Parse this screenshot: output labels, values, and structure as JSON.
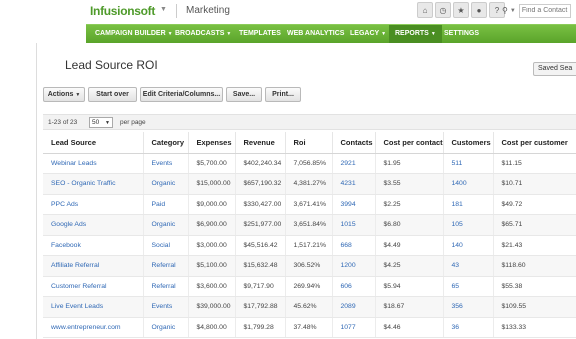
{
  "header": {
    "logo": "Infusionsoft",
    "app_name": "Marketing",
    "search_placeholder": "Find a Contact"
  },
  "nav": {
    "items": [
      {
        "label": "CAMPAIGN BUILDER",
        "caret": true
      },
      {
        "label": "BROADCASTS",
        "caret": true
      },
      {
        "label": "TEMPLATES",
        "caret": false
      },
      {
        "label": "WEB ANALYTICS",
        "caret": false
      },
      {
        "label": "LEGACY",
        "caret": true
      },
      {
        "label": "REPORTS",
        "caret": true,
        "active": true
      },
      {
        "label": "SETTINGS",
        "caret": false
      }
    ]
  },
  "page": {
    "title": "Lead Source ROI",
    "saved_search": "Saved Sea"
  },
  "toolbar": {
    "actions": "Actions",
    "start_over": "Start over",
    "edit_criteria": "Edit Criteria/Columns...",
    "save": "Save...",
    "print": "Print..."
  },
  "pager": {
    "range": "1-23 of 23",
    "page_size": "50",
    "per_page": "per page"
  },
  "table": {
    "columns": [
      "Lead Source",
      "Category",
      "Expenses",
      "Revenue",
      "Roi",
      "Contacts",
      "Cost per contact",
      "Customers",
      "Cost per customer"
    ],
    "rows": [
      [
        "Webinar Leads",
        "Events",
        "$5,700.00",
        "$402,240.34",
        "7,056.85%",
        "2921",
        "$1.95",
        "511",
        "$11.15"
      ],
      [
        "SEO - Organic Traffic",
        "Organic",
        "$15,000.00",
        "$657,190.32",
        "4,381.27%",
        "4231",
        "$3.55",
        "1400",
        "$10.71"
      ],
      [
        "PPC Ads",
        "Paid",
        "$9,000.00",
        "$330,427.00",
        "3,671.41%",
        "3994",
        "$2.25",
        "181",
        "$49.72"
      ],
      [
        "Google Ads",
        "Organic",
        "$6,900.00",
        "$251,977.00",
        "3,651.84%",
        "1015",
        "$6.80",
        "105",
        "$65.71"
      ],
      [
        "Facebook",
        "Social",
        "$3,000.00",
        "$45,516.42",
        "1,517.21%",
        "668",
        "$4.49",
        "140",
        "$21.43"
      ],
      [
        "Affiliate Referral",
        "Referral",
        "$5,100.00",
        "$15,632.48",
        "306.52%",
        "1200",
        "$4.25",
        "43",
        "$118.60"
      ],
      [
        "Customer Referral",
        "Referral",
        "$3,600.00",
        "$9,717.90",
        "269.94%",
        "606",
        "$5.94",
        "65",
        "$55.38"
      ],
      [
        "Live Event Leads",
        "Events",
        "$39,000.00",
        "$17,792.88",
        "45.62%",
        "2089",
        "$18.67",
        "356",
        "$109.55"
      ],
      [
        "www.entrepreneur.com",
        "Organic",
        "$4,800.00",
        "$1,799.28",
        "37.48%",
        "1077",
        "$4.46",
        "36",
        "$133.33"
      ]
    ]
  }
}
